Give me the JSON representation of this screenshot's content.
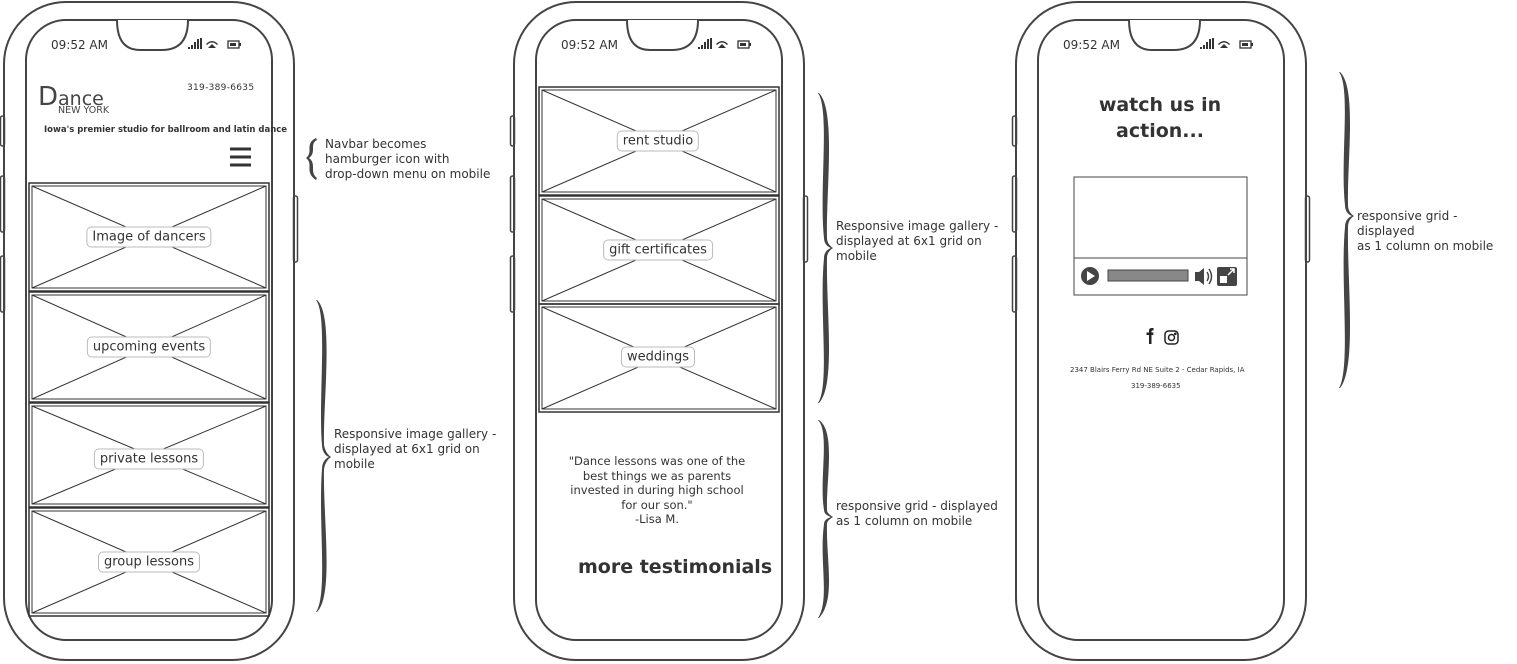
{
  "status_bar": {
    "time": "09:52 AM"
  },
  "phone1": {
    "logo_initial": "D",
    "logo_rest": "ance",
    "logo_sub": "NEW YORK",
    "phone": "319-389-6635",
    "tagline": "Iowa's premier studio for ballroom and latin dance",
    "menu_icon": "hamburger-icon",
    "gallery": [
      "Image of dancers",
      "upcoming events",
      "private lessons",
      "group lessons"
    ]
  },
  "phone2": {
    "gallery": [
      "rent studio",
      "gift certificates",
      "weddings"
    ],
    "testimonial_lines": [
      "\"Dance lessons was one of the",
      "best things we as parents",
      "invested in during high school",
      "for our son.\"",
      "-Lisa M."
    ],
    "more_testimonials": "more testimonials"
  },
  "phone3": {
    "watch_title": "watch us in action...",
    "video_icons": [
      "play-icon",
      "volume-icon",
      "fullscreen-icon"
    ],
    "social_icons": [
      "facebook-icon",
      "instagram-icon"
    ],
    "address": "2347 Blairs Ferry Rd NE Suite 2 - Cedar Rapids, IA",
    "phone": "319-389-6635"
  },
  "annotations": {
    "navbar": [
      "Navbar becomes",
      "hamburger icon with",
      "drop-down menu on mobile"
    ],
    "gallery1": [
      "Responsive image gallery -",
      "displayed at 6x1 grid on",
      "mobile"
    ],
    "gallery2": [
      "Responsive image gallery -",
      "displayed at 6x1 grid on",
      "mobile"
    ],
    "grid2": [
      "responsive grid - displayed",
      "as 1 column on mobile"
    ],
    "grid3": [
      "responsive grid - displayed",
      "as 1 column on mobile"
    ]
  }
}
